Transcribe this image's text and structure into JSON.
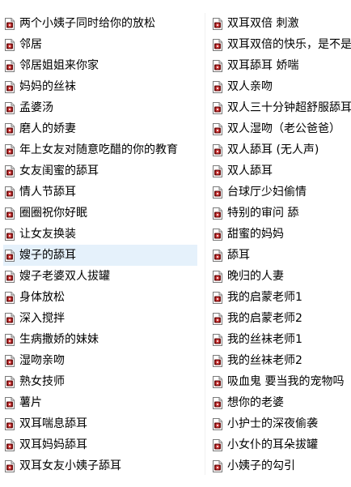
{
  "colors": {
    "background": "#ffffff",
    "text": "#000000",
    "selection": "#e5f1fb"
  },
  "icon": "audio-file-icon",
  "left_column": [
    {
      "label": "两个小姨子同时给你的放松",
      "selected": false
    },
    {
      "label": "邻居",
      "selected": false
    },
    {
      "label": "邻居姐姐来你家",
      "selected": false
    },
    {
      "label": "妈妈的丝袜",
      "selected": false
    },
    {
      "label": "孟婆汤",
      "selected": false
    },
    {
      "label": "磨人的娇妻",
      "selected": false
    },
    {
      "label": "年上女友对随意吃醋的你的教育",
      "selected": false
    },
    {
      "label": "女友闺蜜的舔耳",
      "selected": false
    },
    {
      "label": "情人节舔耳",
      "selected": false
    },
    {
      "label": "圈圈祝你好眠",
      "selected": false
    },
    {
      "label": "让女友换装",
      "selected": false
    },
    {
      "label": "嫂子的舔耳",
      "selected": true
    },
    {
      "label": "嫂子老婆双人拔罐",
      "selected": false
    },
    {
      "label": "身体放松",
      "selected": false
    },
    {
      "label": "深入搅拌",
      "selected": false
    },
    {
      "label": "生病撒娇的妹妹",
      "selected": false
    },
    {
      "label": "湿吻亲吻",
      "selected": false
    },
    {
      "label": "熟女技师",
      "selected": false
    },
    {
      "label": "薯片",
      "selected": false
    },
    {
      "label": "双耳喘息舔耳",
      "selected": false
    },
    {
      "label": "双耳妈妈舔耳",
      "selected": false
    },
    {
      "label": "双耳女友小姨子舔耳",
      "selected": false
    }
  ],
  "right_column": [
    {
      "label": "双耳双倍 刺激",
      "selected": false
    },
    {
      "label": "双耳双倍的快乐，是不是",
      "selected": false
    },
    {
      "label": "双耳舔耳 娇喘",
      "selected": false
    },
    {
      "label": "双人亲吻",
      "selected": false
    },
    {
      "label": "双人三十分钟超舒服舔耳",
      "selected": false
    },
    {
      "label": "双人湿吻（老公爸爸）",
      "selected": false
    },
    {
      "label": "双人舔耳 (无人声)",
      "selected": false
    },
    {
      "label": "双人舔耳",
      "selected": false
    },
    {
      "label": "台球厅少妇偷情",
      "selected": false
    },
    {
      "label": "特别的审问 舔",
      "selected": false
    },
    {
      "label": "甜蜜的妈妈",
      "selected": false
    },
    {
      "label": "舔耳",
      "selected": false
    },
    {
      "label": "晚归的人妻",
      "selected": false
    },
    {
      "label": "我的启蒙老师1",
      "selected": false
    },
    {
      "label": "我的启蒙老师2",
      "selected": false
    },
    {
      "label": "我的丝袜老师1",
      "selected": false
    },
    {
      "label": "我的丝袜老师2",
      "selected": false
    },
    {
      "label": "吸血鬼 要当我的宠物吗",
      "selected": false
    },
    {
      "label": "想你的老婆",
      "selected": false
    },
    {
      "label": "小护士的深夜偷袭",
      "selected": false
    },
    {
      "label": "小女仆的耳朵拔罐",
      "selected": false
    },
    {
      "label": "小姨子的勾引",
      "selected": false
    }
  ]
}
